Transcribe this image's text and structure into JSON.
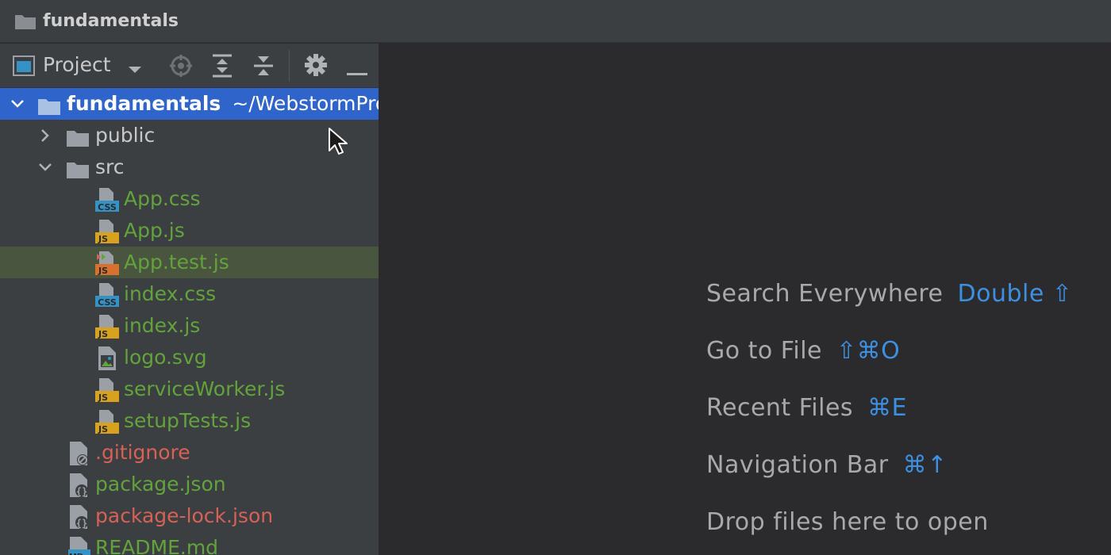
{
  "window": {
    "title": "fundamentals"
  },
  "project_panel": {
    "title": "Project",
    "toolbar_icons": [
      "project-view-icon",
      "dropdown-arrow-icon",
      "locate-icon",
      "expand-all-icon",
      "collapse-all-icon",
      "gear-icon",
      "minimize-icon"
    ]
  },
  "tree": {
    "root": {
      "name": "fundamentals",
      "path": "~/WebstormPro"
    },
    "public": {
      "name": "public"
    },
    "src": {
      "name": "src"
    },
    "files": {
      "app_css": "App.css",
      "app_js": "App.js",
      "app_test_js": "App.test.js",
      "index_css": "index.css",
      "index_js": "index.js",
      "logo_svg": "logo.svg",
      "service_worker_js": "serviceWorker.js",
      "setup_tests_js": "setupTests.js",
      "gitignore": ".gitignore",
      "package_json": "package.json",
      "package_lock_json": "package-lock.json",
      "readme_md": "README.md"
    }
  },
  "editor_hints": {
    "search_everywhere": {
      "label": "Search Everywhere",
      "shortcut": "Double ⇧"
    },
    "go_to_file": {
      "label": "Go to File",
      "shortcut": "⇧⌘O"
    },
    "recent_files": {
      "label": "Recent Files",
      "shortcut": "⌘E"
    },
    "navigation_bar": {
      "label": "Navigation Bar",
      "shortcut": "⌘↑"
    },
    "drop_files": {
      "label": "Drop files here to open"
    }
  },
  "colors": {
    "selection": "#2f65ca",
    "highlight_row": "#4a5540",
    "vcs_added": "#62a33c",
    "vcs_ignored": "#d66157",
    "shortcut": "#3d8fe0"
  }
}
